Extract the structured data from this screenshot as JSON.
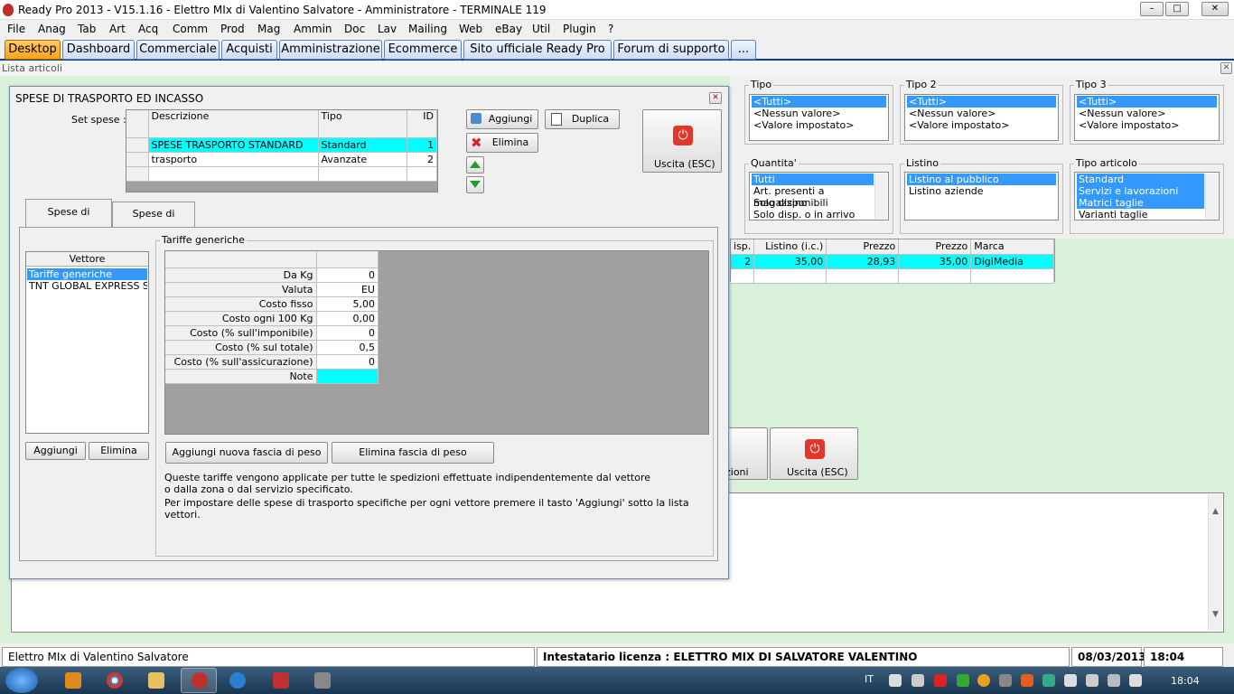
{
  "window": {
    "title": "Ready Pro 2013 - V15.1.16 - Elettro MIx di Valentino Salvatore - Amministratore - TERMINALE 119",
    "min": "–",
    "max": "□",
    "close": "✕"
  },
  "menu": [
    "File",
    "Anag",
    "Tab",
    "Art",
    "Acq",
    "Comm",
    "Prod",
    "Mag",
    "Ammin",
    "Doc",
    "Lav",
    "Mailing",
    "Web",
    "eBay",
    "Util",
    "Plugin",
    "?"
  ],
  "tabs": [
    "Desktop",
    "Dashboard",
    "Commerciale",
    "Acquisti",
    "Amministrazione",
    "Ecommerce",
    "Sito ufficiale Ready Pro",
    "Forum di supporto",
    "..."
  ],
  "subheader": {
    "title": "Lista articoli",
    "close": "✕"
  },
  "filters": {
    "tipo": {
      "label": "Tipo",
      "items": [
        "<Tutti>",
        "<Nessun valore>",
        "<Valore impostato>"
      ]
    },
    "tipo2": {
      "label": "Tipo 2",
      "items": [
        "<Tutti>",
        "<Nessun valore>",
        "<Valore impostato>"
      ]
    },
    "tipo3": {
      "label": "Tipo 3",
      "items": [
        "<Tutti>",
        "<Nessun valore>",
        "<Valore impostato>"
      ]
    },
    "quantita": {
      "label": "Quantita'",
      "items": [
        "Tutti",
        "Art. presenti a magazzino",
        "Solo disponibili",
        "Solo disp. o in arrivo"
      ]
    },
    "listino": {
      "label": "Listino",
      "items": [
        "Listino al pubblico",
        "Listino aziende"
      ]
    },
    "tipo_articolo": {
      "label": "Tipo articolo",
      "items": [
        "Standard",
        "Servizi e lavorazioni",
        "Matrici taglie",
        "Varianti taglie"
      ]
    }
  },
  "articles": {
    "headers": [
      "isp.",
      "Listino (i.c.)",
      "Prezzo",
      "Prezzo",
      "Marca"
    ],
    "row": [
      "2",
      "35,00",
      "28,93",
      "35,00",
      "DigiMedia"
    ]
  },
  "bg_buttons": {
    "partial": "zioni",
    "exit": "Uscita (ESC)"
  },
  "dialog": {
    "title": "SPESE DI TRASPORTO ED INCASSO",
    "close": "✕",
    "set_label": "Set spese :",
    "set_headers": [
      "Descrizione",
      "Tipo",
      "ID"
    ],
    "set_rows": [
      [
        "SPESE TRASPORTO STANDARD",
        "Standard",
        "1"
      ],
      [
        "trasporto",
        "Avanzate",
        "2"
      ]
    ],
    "btn_add": "Aggiungi",
    "btn_dup": "Duplica",
    "btn_del": "Elimina",
    "btn_exit": "Uscita (ESC)",
    "tab_transport": "Spese di trasporto",
    "tab_collect": "Spese di incasso",
    "carrier_header": "Vettore",
    "carriers": [
      "Tariffe generiche",
      "TNT GLOBAL EXPRESS SF"
    ],
    "carrier_add": "Aggiungi",
    "carrier_del": "Elimina",
    "tariff_legend": "Tariffe generiche",
    "tariff_rows": [
      [
        "Da Kg",
        "0"
      ],
      [
        "Valuta",
        "EU"
      ],
      [
        "Costo fisso",
        "5,00"
      ],
      [
        "Costo ogni 100 Kg",
        "0,00"
      ],
      [
        "Costo (% sull'imponibile)",
        "0"
      ],
      [
        "Costo (% sul totale)",
        "0,5"
      ],
      [
        "Costo (% sull'assicurazione)",
        "0"
      ],
      [
        "Note",
        ""
      ]
    ],
    "btn_add_band": "Aggiungi nuova fascia di peso",
    "btn_del_band": "Elimina fascia di peso",
    "info1": "Queste tariffe vengono applicate per tutte le spedizioni effettuate indipendentemente dal vettore o dalla zona o dal servizio specificato.",
    "info2": "Per impostare delle spese di trasporto specifiche per ogni vettore premere il tasto 'Aggiungi' sotto la lista vettori."
  },
  "status": {
    "company": "Elettro MIx di Valentino Salvatore",
    "license": "Intestatario licenza : ELETTRO MIX DI SALVATORE VALENTINO",
    "date": "08/03/2013",
    "time": "18:04"
  },
  "taskbar": {
    "lang": "IT",
    "clock": "18:04"
  }
}
